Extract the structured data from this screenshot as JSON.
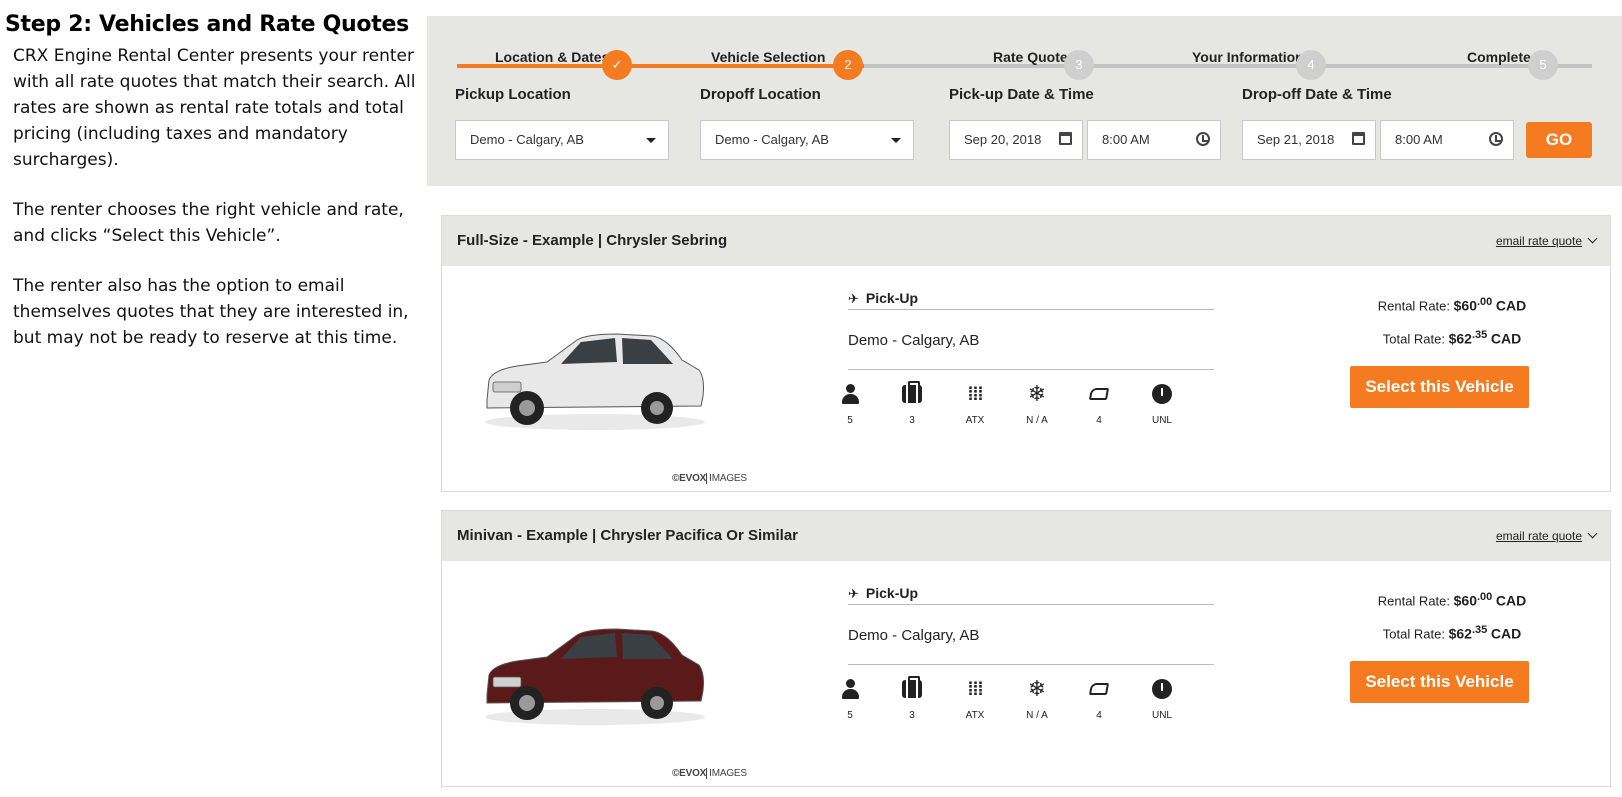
{
  "description": {
    "heading": "Step 2: Vehicles and Rate Quotes",
    "para1": "CRX Engine Rental Center presents your renter with all rate quotes that match their search. All rates are shown as rental rate totals and total pricing (including taxes and mandatory surcharges).",
    "para2": "The renter chooses the right vehicle and rate, and clicks “Select this Vehicle”.",
    "para3": "The renter also has the option to email themselves quotes that they are interested in, but may not be ready to reserve at this time."
  },
  "steps": [
    {
      "label": "Location & Dates",
      "marker": "✓",
      "state": "done"
    },
    {
      "label": "Vehicle Selection",
      "marker": "2",
      "state": "active"
    },
    {
      "label": "Rate Quote",
      "marker": "3",
      "state": "pending"
    },
    {
      "label": "Your Information",
      "marker": "4",
      "state": "pending"
    },
    {
      "label": "Complete",
      "marker": "5",
      "state": "pending"
    }
  ],
  "search": {
    "pickup_label": "Pickup Location",
    "pickup_value": "Demo - Calgary, AB",
    "dropoff_label": "Dropoff Location",
    "dropoff_value": "Demo - Calgary, AB",
    "pickup_dt_label": "Pick-up Date & Time",
    "pickup_date": "Sep 20, 2018",
    "pickup_time": "8:00 AM",
    "dropoff_dt_label": "Drop-off Date & Time",
    "dropoff_date": "Sep 21, 2018",
    "dropoff_time": "8:00 AM",
    "go_label": "GO"
  },
  "accent_color": "#f47b20",
  "vehicles": [
    {
      "title": "Full-Size - Example | Chrysler Sebring",
      "email_link": "email rate quote",
      "image_credit_brand": "©EVOX",
      "image_credit_suffix": "IMAGES",
      "pickup_label": "Pick-Up",
      "pickup_location": "Demo - Calgary, AB",
      "features": [
        {
          "icon": "person-icon",
          "value": "5"
        },
        {
          "icon": "luggage-icon",
          "value": "3"
        },
        {
          "icon": "transmission-icon",
          "value": "ATX"
        },
        {
          "icon": "snowflake-icon",
          "value": "N / A"
        },
        {
          "icon": "car-door-icon",
          "value": "4"
        },
        {
          "icon": "mileage-gauge-icon",
          "value": "UNL"
        }
      ],
      "rental_rate_label": "Rental Rate:",
      "rental_rate_main": "$60",
      "rental_rate_cents": ".00",
      "rental_rate_currency": "CAD",
      "total_rate_label": "Total Rate:",
      "total_rate_main": "$62",
      "total_rate_cents": ".35",
      "total_rate_currency": "CAD",
      "select_label": "Select this Vehicle",
      "car_color": "#e8e8e8"
    },
    {
      "title": "Minivan - Example | Chrysler Pacifica Or Similar",
      "email_link": "email rate quote",
      "image_credit_brand": "©EVOX",
      "image_credit_suffix": "IMAGES",
      "pickup_label": "Pick-Up",
      "pickup_location": "Demo - Calgary, AB",
      "features": [
        {
          "icon": "person-icon",
          "value": "5"
        },
        {
          "icon": "luggage-icon",
          "value": "3"
        },
        {
          "icon": "transmission-icon",
          "value": "ATX"
        },
        {
          "icon": "snowflake-icon",
          "value": "N / A"
        },
        {
          "icon": "car-door-icon",
          "value": "4"
        },
        {
          "icon": "mileage-gauge-icon",
          "value": "UNL"
        }
      ],
      "rental_rate_label": "Rental Rate:",
      "rental_rate_main": "$60",
      "rental_rate_cents": ".00",
      "rental_rate_currency": "CAD",
      "total_rate_label": "Total Rate:",
      "total_rate_main": "$62",
      "total_rate_cents": ".35",
      "total_rate_currency": "CAD",
      "select_label": "Select this Vehicle",
      "car_color": "#5a1a1a"
    }
  ]
}
